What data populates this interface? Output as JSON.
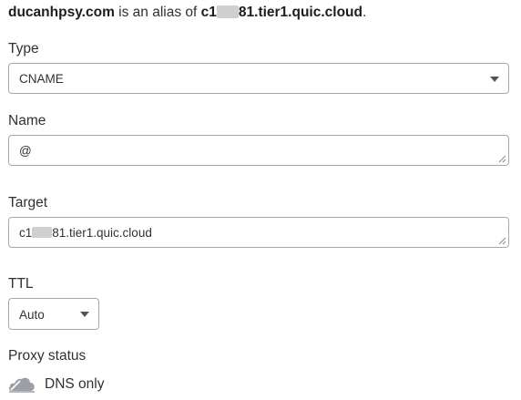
{
  "summary": {
    "domain": "ducanhpsy.com",
    "middle": " is an alias of ",
    "target_prefix": "c1",
    "target_suffix": "81.tier1.quic.cloud",
    "end": "."
  },
  "type_field": {
    "label": "Type",
    "value": "CNAME"
  },
  "name_field": {
    "label": "Name",
    "value": "@"
  },
  "target_field": {
    "label": "Target",
    "value_prefix": "c1",
    "value_suffix": "81.tier1.quic.cloud"
  },
  "ttl_field": {
    "label": "TTL",
    "value": "Auto"
  },
  "proxy": {
    "label": "Proxy status",
    "value": "DNS only",
    "icon": "cloud-icon"
  }
}
